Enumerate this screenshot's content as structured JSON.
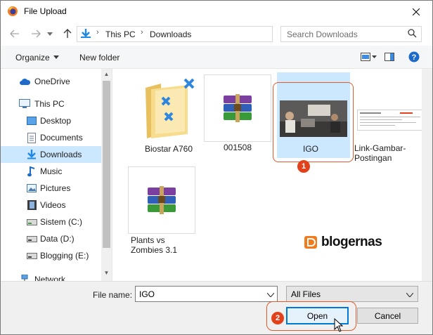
{
  "window": {
    "title": "File Upload"
  },
  "nav": {
    "breadcrumb": [
      "This PC",
      "Downloads"
    ],
    "search_placeholder": "Search Downloads"
  },
  "toolbar": {
    "organize": "Organize",
    "new_folder": "New folder"
  },
  "sidebar": {
    "items": [
      {
        "label": "OneDrive",
        "icon": "cloud-icon"
      },
      {
        "label": "This PC",
        "icon": "computer-icon"
      },
      {
        "label": "Desktop",
        "icon": "desktop-icon"
      },
      {
        "label": "Documents",
        "icon": "documents-icon"
      },
      {
        "label": "Downloads",
        "icon": "download-arrow-icon",
        "selected": true
      },
      {
        "label": "Music",
        "icon": "music-note-icon"
      },
      {
        "label": "Pictures",
        "icon": "pictures-icon"
      },
      {
        "label": "Videos",
        "icon": "film-icon"
      },
      {
        "label": "Sistem (C:)",
        "icon": "drive-icon"
      },
      {
        "label": "Data (D:)",
        "icon": "drive-icon"
      },
      {
        "label": "Blogging (E:)",
        "icon": "drive-icon"
      },
      {
        "label": "Network",
        "icon": "network-icon"
      }
    ]
  },
  "files": [
    {
      "name": "Biostar A760",
      "type": "folder"
    },
    {
      "name": "001508",
      "type": "archive"
    },
    {
      "name": "IGO",
      "type": "image",
      "selected": true
    },
    {
      "name": "Link-Gambar-Postingan",
      "type": "image"
    },
    {
      "name": "Plants vs Zombies 3.1",
      "type": "archive"
    }
  ],
  "bottom": {
    "filename_label": "File name:",
    "filename_value": "IGO",
    "filter_value": "All Files",
    "open_label": "Open",
    "cancel_label": "Cancel"
  },
  "annotations": {
    "badge1": "1",
    "badge2": "2",
    "watermark": "blogernas"
  },
  "colors": {
    "selection": "#cce8ff",
    "accent": "#0078d7",
    "annotation": "#e2421b"
  }
}
